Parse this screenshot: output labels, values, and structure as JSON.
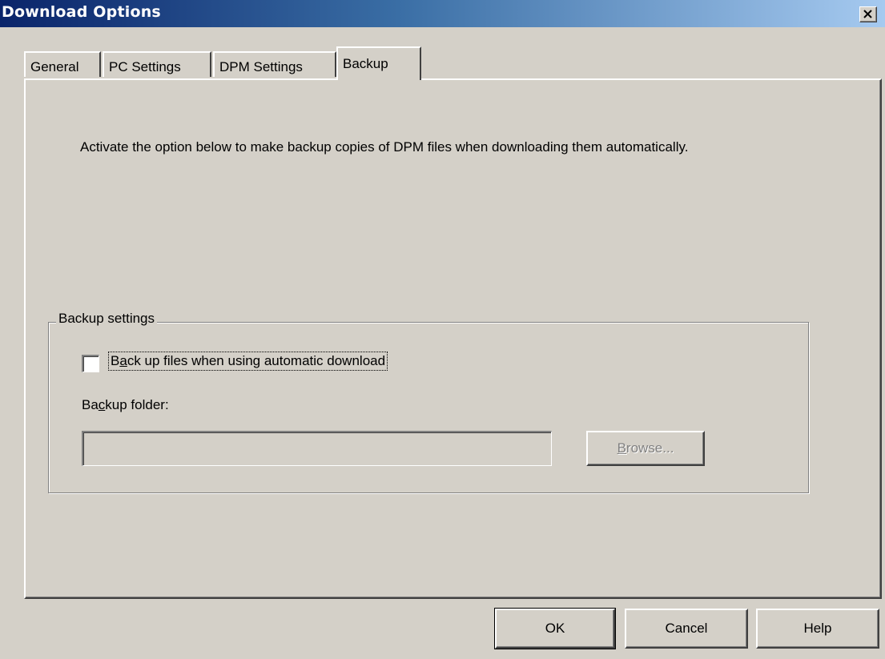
{
  "window": {
    "title": "Download Options",
    "close_icon": "close-icon"
  },
  "tabs": [
    {
      "label": "General",
      "active": false
    },
    {
      "label": "PC Settings",
      "active": false
    },
    {
      "label": "DPM Settings",
      "active": false
    },
    {
      "label": "Backup",
      "active": true
    }
  ],
  "backup_tab": {
    "description": "Activate the option below to make backup copies of DPM files when downloading them automatically.",
    "group_label": "Backup settings",
    "checkbox": {
      "label_prefix": "B",
      "label_mnemonic": "a",
      "label_suffix": "ck up files when using automatic download",
      "checked": false
    },
    "folder": {
      "label_prefix": "Ba",
      "label_mnemonic": "c",
      "label_suffix": "kup folder:",
      "value": "",
      "browse_mnemonic": "B",
      "browse_suffix": "rowse...",
      "browse_enabled": false
    }
  },
  "buttons": {
    "ok": "OK",
    "cancel": "Cancel",
    "help": "Help"
  }
}
